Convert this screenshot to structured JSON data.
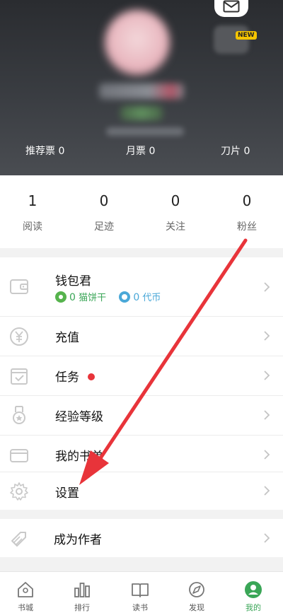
{
  "header": {
    "stats": [
      {
        "label": "推荐票 0"
      },
      {
        "label": "月票 0"
      },
      {
        "label": "刀片 0"
      }
    ],
    "new_badge": "NEW",
    "icons": {
      "mail": "mail-icon"
    }
  },
  "counts": [
    {
      "value": "1",
      "label": "阅读"
    },
    {
      "value": "0",
      "label": "足迹"
    },
    {
      "value": "0",
      "label": "关注"
    },
    {
      "value": "0",
      "label": "粉丝"
    }
  ],
  "wallet": {
    "title": "钱包君",
    "biscuits_value": "0",
    "biscuits_label": "猫饼干",
    "coins_value": "0",
    "coins_label": "代币"
  },
  "menu": [
    {
      "label": "充值",
      "icon": "yuan-circle-icon"
    },
    {
      "label": "任务",
      "icon": "task-checkbox-icon"
    },
    {
      "label": "经验等级",
      "icon": "medal-icon"
    },
    {
      "label": "我的书单",
      "icon": "book-list-icon"
    },
    {
      "label": "设置",
      "icon": "gear-icon"
    }
  ],
  "author": {
    "label": "成为作者",
    "icon": "pencil-tag-icon"
  },
  "bottom_nav": [
    {
      "label": "书城",
      "icon": "home-icon",
      "active": false
    },
    {
      "label": "排行",
      "icon": "bar-chart-icon",
      "active": false
    },
    {
      "label": "读书",
      "icon": "book-icon",
      "active": false
    },
    {
      "label": "发现",
      "icon": "compass-icon",
      "active": false
    },
    {
      "label": "我的",
      "icon": "profile-icon",
      "active": true
    }
  ],
  "colors": {
    "accent": "#3aa657",
    "arrow": "#e8343a",
    "biscuit_green": "#56b34d",
    "coin_blue": "#4aa8d8"
  }
}
